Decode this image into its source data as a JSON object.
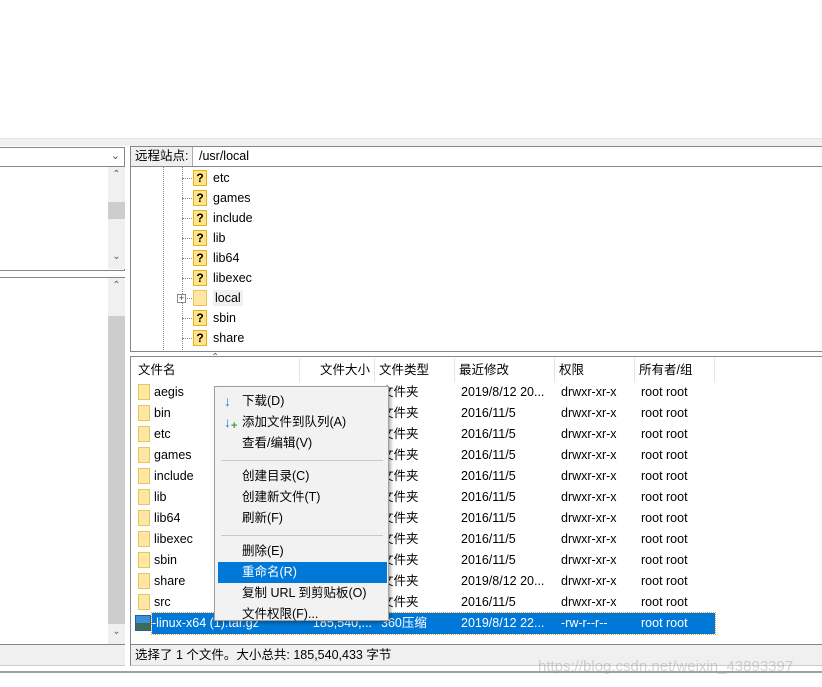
{
  "remote_site": {
    "label": "远程站点:",
    "path": "/usr/local"
  },
  "remote_tree": [
    {
      "name": "etc",
      "icon": "unknown-folder-icon"
    },
    {
      "name": "games",
      "icon": "unknown-folder-icon"
    },
    {
      "name": "include",
      "icon": "unknown-folder-icon"
    },
    {
      "name": "lib",
      "icon": "unknown-folder-icon"
    },
    {
      "name": "lib64",
      "icon": "unknown-folder-icon"
    },
    {
      "name": "libexec",
      "icon": "unknown-folder-icon"
    },
    {
      "name": "local",
      "icon": "folder-icon",
      "expandable": true,
      "selected": true
    },
    {
      "name": "sbin",
      "icon": "unknown-folder-icon"
    },
    {
      "name": "share",
      "icon": "unknown-folder-icon"
    }
  ],
  "columns": [
    "文件名",
    "文件大小",
    "文件类型",
    "最近修改",
    "权限",
    "所有者/组"
  ],
  "files": [
    {
      "name": "aegis",
      "size": "",
      "type": "文件夹",
      "modified": "2019/8/12 20...",
      "perm": "drwxr-xr-x",
      "owner": "root root"
    },
    {
      "name": "bin",
      "size": "",
      "type": "文件夹",
      "modified": "2016/11/5",
      "perm": "drwxr-xr-x",
      "owner": "root root"
    },
    {
      "name": "etc",
      "size": "",
      "type": "文件夹",
      "modified": "2016/11/5",
      "perm": "drwxr-xr-x",
      "owner": "root root"
    },
    {
      "name": "games",
      "size": "",
      "type": "文件夹",
      "modified": "2016/11/5",
      "perm": "drwxr-xr-x",
      "owner": "root root"
    },
    {
      "name": "include",
      "size": "",
      "type": "文件夹",
      "modified": "2016/11/5",
      "perm": "drwxr-xr-x",
      "owner": "root root"
    },
    {
      "name": "lib",
      "size": "",
      "type": "文件夹",
      "modified": "2016/11/5",
      "perm": "drwxr-xr-x",
      "owner": "root root"
    },
    {
      "name": "lib64",
      "size": "",
      "type": "文件夹",
      "modified": "2016/11/5",
      "perm": "drwxr-xr-x",
      "owner": "root root"
    },
    {
      "name": "libexec",
      "size": "",
      "type": "文件夹",
      "modified": "2016/11/5",
      "perm": "drwxr-xr-x",
      "owner": "root root"
    },
    {
      "name": "sbin",
      "size": "",
      "type": "文件夹",
      "modified": "2016/11/5",
      "perm": "drwxr-xr-x",
      "owner": "root root"
    },
    {
      "name": "share",
      "size": "",
      "type": "文件夹",
      "modified": "2019/8/12 20...",
      "perm": "drwxr-xr-x",
      "owner": "root root"
    },
    {
      "name": "src",
      "size": "",
      "type": "文件夹",
      "modified": "2016/11/5",
      "perm": "drwxr-xr-x",
      "owner": "root root"
    },
    {
      "name": "jdk-linux-x64 (1).tar.gz",
      "size": "185,540,...",
      "type": "360压缩",
      "modified": "2019/8/12 22...",
      "perm": "-rw-r--r--",
      "owner": "root root",
      "selected": true
    }
  ],
  "context_menu": {
    "items": [
      {
        "label": "下载(D)",
        "icon": "download-arrow-icon"
      },
      {
        "label": "添加文件到队列(A)",
        "icon": "add-to-queue-icon"
      },
      {
        "label": "查看/编辑(V)"
      },
      {
        "separator": true
      },
      {
        "label": "创建目录(C)"
      },
      {
        "label": "创建新文件(T)"
      },
      {
        "label": "刷新(F)"
      },
      {
        "separator": true
      },
      {
        "label": "删除(E)"
      },
      {
        "label": "重命名(R)",
        "highlighted": true
      },
      {
        "label": "复制 URL 到剪贴板(O)"
      },
      {
        "label": "文件权限(F)..."
      }
    ]
  },
  "status": {
    "remote": "选择了 1 个文件。大小总共: 185,540,433 字节"
  },
  "watermark": "https://blog.csdn.net/weixin_43893397",
  "colors": {
    "selection": "#0078d7",
    "folder": "#fde7a2"
  }
}
